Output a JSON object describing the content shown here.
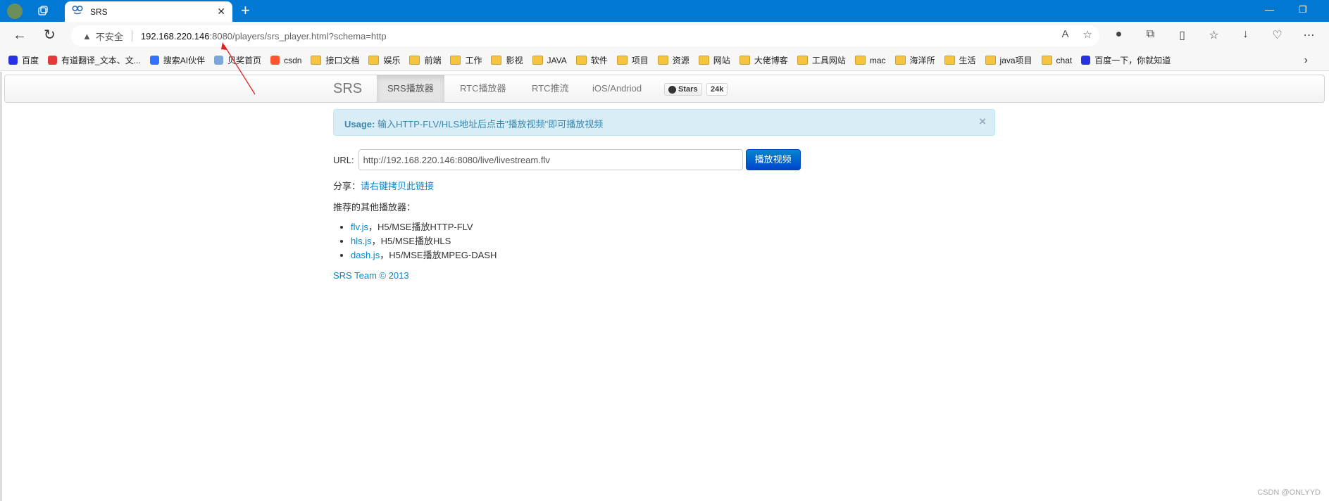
{
  "browser": {
    "tab_title": "SRS",
    "url_host": "192.168.220.146",
    "url_rest": ":8080/players/srs_player.html?schema=http",
    "insecure_label": "不安全",
    "bookmarks": [
      {
        "label": "百度",
        "icon": "baidu-icon",
        "color": "#2932e1"
      },
      {
        "label": "有道翻译_文本、文...",
        "icon": "youdao-icon",
        "color": "#e23a3a"
      },
      {
        "label": "搜索AI伙伴",
        "icon": "ai-icon",
        "color": "#3370ff"
      },
      {
        "label": "贝奖首页",
        "icon": "bei-icon",
        "color": "#7aa7d8"
      },
      {
        "label": "csdn",
        "icon": "csdn-icon",
        "color": "#fc5531"
      },
      {
        "label": "接口文档",
        "icon": "folder-icon"
      },
      {
        "label": "娱乐",
        "icon": "folder-icon"
      },
      {
        "label": "前端",
        "icon": "folder-icon"
      },
      {
        "label": "工作",
        "icon": "folder-icon"
      },
      {
        "label": "影视",
        "icon": "folder-icon"
      },
      {
        "label": "JAVA",
        "icon": "folder-icon"
      },
      {
        "label": "软件",
        "icon": "folder-icon"
      },
      {
        "label": "项目",
        "icon": "folder-icon"
      },
      {
        "label": "资源",
        "icon": "folder-icon"
      },
      {
        "label": "网站",
        "icon": "folder-icon"
      },
      {
        "label": "大佬博客",
        "icon": "folder-icon"
      },
      {
        "label": "工具网站",
        "icon": "folder-icon"
      },
      {
        "label": "mac",
        "icon": "folder-icon"
      },
      {
        "label": "海洋所",
        "icon": "folder-icon"
      },
      {
        "label": "生活",
        "icon": "folder-icon"
      },
      {
        "label": "java项目",
        "icon": "folder-icon"
      },
      {
        "label": "chat",
        "icon": "folder-icon"
      },
      {
        "label": "百度一下，你就知道",
        "icon": "baidu-icon",
        "color": "#2932e1"
      }
    ]
  },
  "navbar": {
    "brand": "SRS",
    "items": [
      "SRS播放器",
      "RTC播放器",
      "RTC推流",
      "iOS/Andriod"
    ],
    "github_stars_label": "Stars",
    "github_stars_count": "24k"
  },
  "alert": {
    "strong": "Usage:",
    "text": " 输入HTTP-FLV/HLS地址后点击\"播放视频\"即可播放视频",
    "close": "×"
  },
  "form": {
    "url_label": "URL:",
    "url_value": "http://192.168.220.146:8080/live/livestream.flv",
    "play_button": "播放视频"
  },
  "share": {
    "label": "分享：",
    "link": "请右键拷贝此链接"
  },
  "recommend_heading": "推荐的其他播放器：",
  "players": [
    {
      "name": "flv.js",
      "desc": "，H5/MSE播放HTTP-FLV"
    },
    {
      "name": "hls.js",
      "desc": "，H5/MSE播放HLS"
    },
    {
      "name": "dash.js",
      "desc": "，H5/MSE播放MPEG-DASH"
    }
  ],
  "footer": "SRS Team © 2013",
  "watermark": "CSDN @ONLYYD"
}
